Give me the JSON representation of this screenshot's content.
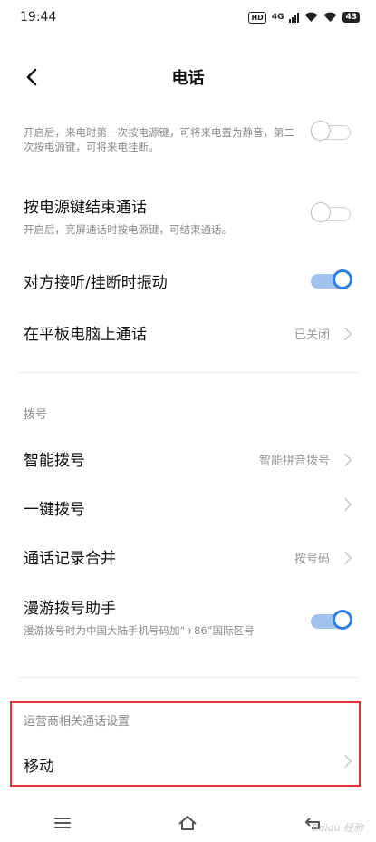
{
  "status_bar": {
    "time": "19:44",
    "network": "4G",
    "hd_badge": "HD",
    "battery": "43"
  },
  "header": {
    "title": "电话"
  },
  "settings": {
    "power_key_mute_desc": "开启后，来电时第一次按电源键，可将来电置为静音，第二次按电源键，可将来电挂断。",
    "power_key_end": {
      "label": "按电源键结束通话",
      "desc": "开启后，亮屏通话时按电源键，可结束通话。",
      "enabled": false
    },
    "vibrate": {
      "label": "对方接听/挂断时振动",
      "enabled": true
    },
    "tablet_call": {
      "label": "在平板电脑上通话",
      "value": "已关闭"
    }
  },
  "dialing": {
    "section_title": "拨号",
    "smart_dial": {
      "label": "智能拨号",
      "value": "智能拼音拨号"
    },
    "one_key_dial": {
      "label": "一键拨号"
    },
    "merge_records": {
      "label": "通话记录合并",
      "value": "按号码"
    },
    "roaming_assistant": {
      "label": "漫游拨号助手",
      "desc": "漫游拨号时为中国大陆手机号码加“+86”国际区号",
      "enabled": true
    }
  },
  "carrier": {
    "section_title": "运营商相关通话设置",
    "mobile": {
      "label": "移动"
    }
  },
  "colors": {
    "accent": "#2f7fe6",
    "highlight": "#e23636"
  },
  "watermark": "Baidu 经验"
}
